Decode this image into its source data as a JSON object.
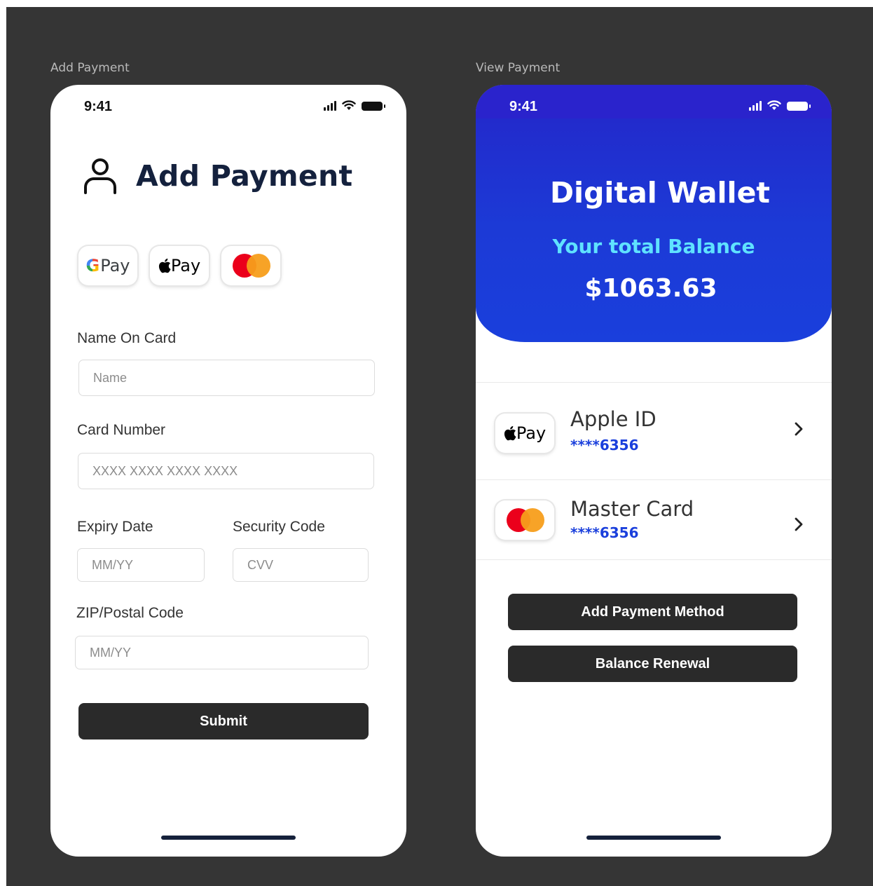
{
  "frames": {
    "left_label": "Add Payment",
    "right_label": "View Payment"
  },
  "status": {
    "time": "9:41"
  },
  "add_payment": {
    "title": "Add Payment",
    "pay_options": [
      {
        "name": "Google Pay",
        "text": "Pay",
        "icon": "google-g-icon"
      },
      {
        "name": "Apple Pay",
        "text": "Pay",
        "icon": "apple-icon"
      },
      {
        "name": "Mastercard",
        "icon": "mastercard-icon"
      }
    ],
    "name_label": "Name On Card",
    "name_placeholder": "Name",
    "card_label": "Card Number",
    "card_placeholder": "XXXX XXXX XXXX XXXX",
    "expiry_label": "Expiry Date",
    "expiry_placeholder": "MM/YY",
    "security_label": "Security Code",
    "security_placeholder": "CVV",
    "zip_label": "ZIP/Postal Code",
    "zip_placeholder": "MM/YY",
    "submit_label": "Submit"
  },
  "view_payment": {
    "title": "Digital Wallet",
    "balance_label": "Your total Balance",
    "balance": "$1063.63",
    "methods": [
      {
        "name": "Apple ID",
        "number": "****6356",
        "icon": "apple-pay-icon"
      },
      {
        "name": "Master Card",
        "number": "****6356",
        "icon": "mastercard-icon"
      }
    ],
    "add_method_label": "Add Payment Method",
    "renewal_label": "Balance Renewal"
  },
  "colors": {
    "background": "#353535",
    "hero_blue": "#1c3ad6",
    "balance_label": "#5fe2ff",
    "title_navy": "#14213d",
    "button_dark": "#2a2a2a"
  }
}
